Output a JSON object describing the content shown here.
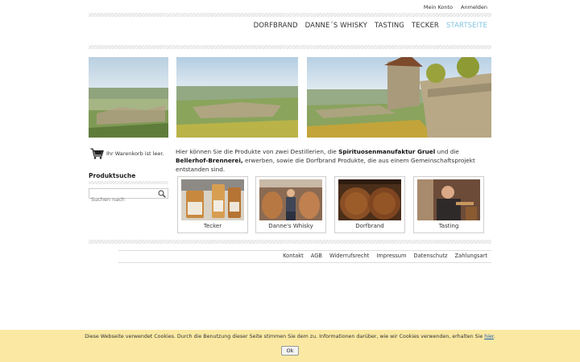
{
  "topbar": {
    "account": "Mein Konto",
    "login": "Anmelden"
  },
  "nav": {
    "items": [
      "DORFBRAND",
      "DANNE´S WHISKY",
      "TASTING",
      "TECKER"
    ],
    "active": "STARTSEITE",
    "active_color": "#7fc3e0"
  },
  "sidebar": {
    "cart_text": "Ihr Warenkorb ist leer.",
    "search_title": "Produktsuche",
    "search_placeholder": "Suchen nach"
  },
  "intro": {
    "part1": "Hier können Sie die Produkte von zwei Destillerien, die ",
    "brand1": "Spirituosenmanufaktur Gruel",
    "part2": " und die ",
    "brand2": "Bellerhof-Brennerei,",
    "part3": " erwerben, sowie die Dorfbrand Produkte, die aus einem Gemeinschaftsprojekt entstanden sind."
  },
  "tiles": [
    "Tecker",
    "Danne's Whisky",
    "Dorfbrand",
    "Tasting"
  ],
  "footer": {
    "links": [
      "Kontakt",
      "AGB",
      "Widerrufsrecht",
      "Impressum",
      "Datenschutz",
      "Zahlungsart"
    ]
  },
  "cookie": {
    "message": "Diese Webseite verwendet Cookies. Durch die Benutzung dieser Seite stimmen Sie dem zu. Informationen darüber, wie wir Cookies verwenden, erhalten Sie ",
    "link": "hier",
    "end": ".",
    "ok": "Ok",
    "background": "#fbe9a3"
  },
  "icons": {
    "cart": "shopping-cart-icon",
    "search": "magnifier-icon"
  }
}
